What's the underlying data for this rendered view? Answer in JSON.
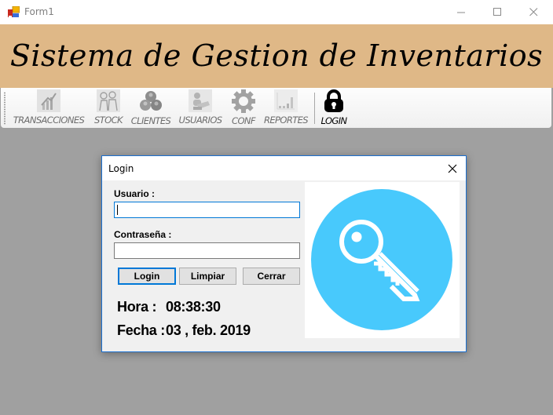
{
  "window": {
    "title": "Form1",
    "icon": "winforms-app-icon",
    "controls": {
      "minimize": "minimize-icon",
      "maximize": "maximize-icon",
      "close": "close-icon"
    }
  },
  "banner": {
    "title": "Sistema de Gestion de Inventarios"
  },
  "toolbar": {
    "items": [
      {
        "label": "TRANSACCIONES",
        "icon": "chart-growth-icon",
        "enabled": false
      },
      {
        "label": "STOCK",
        "icon": "stock-people-icon",
        "enabled": false
      },
      {
        "label": "CLIENTES",
        "icon": "clients-group-icon",
        "enabled": false
      },
      {
        "label": "USUARIOS",
        "icon": "users-icon",
        "enabled": false
      },
      {
        "label": "CONF",
        "icon": "gear-icon",
        "enabled": false
      },
      {
        "label": "REPORTES",
        "icon": "bar-report-icon",
        "enabled": false
      },
      {
        "label": "LOGIN",
        "icon": "padlock-icon",
        "enabled": true
      }
    ]
  },
  "dialog": {
    "title": "Login",
    "close_icon": "close-icon",
    "usuario_label": "Usuario :",
    "usuario_value": "",
    "password_label": "Contraseña :",
    "password_value": "",
    "buttons": {
      "login": "Login",
      "clear": "Limpiar",
      "close": "Cerrar"
    },
    "time_label": "Hora :",
    "time_value": "08:38:30",
    "date_label": "Fecha :",
    "date_value": "03 , feb. 2019",
    "picture_icon": "key-icon",
    "colors": {
      "picture_circle": "#48c9fc",
      "accent": "#0078d7"
    }
  },
  "colors": {
    "banner": "#dfb887",
    "background": "#a0a0a0"
  }
}
